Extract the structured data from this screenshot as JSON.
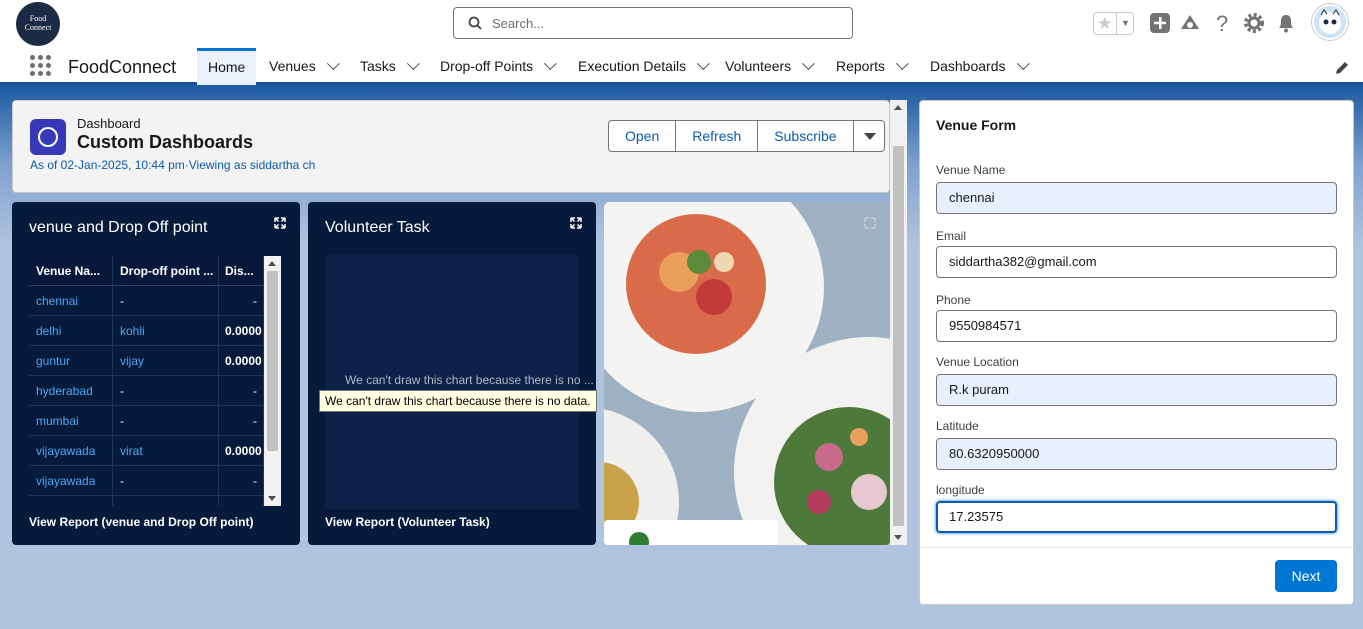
{
  "topbar": {
    "logo_text_line1": "Food",
    "logo_text_line2": "Connect",
    "search_placeholder": "Search..."
  },
  "nav": {
    "app_name": "FoodConnect",
    "tabs": [
      {
        "label": "Home",
        "active": true
      },
      {
        "label": "Venues"
      },
      {
        "label": "Tasks"
      },
      {
        "label": "Drop-off Points"
      },
      {
        "label": "Execution Details"
      },
      {
        "label": "Volunteers"
      },
      {
        "label": "Reports"
      },
      {
        "label": "Dashboards"
      }
    ]
  },
  "dashboard": {
    "breadcrumb": "Dashboard",
    "title": "Custom Dashboards",
    "as_of": "As of 02-Jan-2025, 10:44 pm·Viewing as siddartha ch",
    "buttons": {
      "open": "Open",
      "refresh": "Refresh",
      "subscribe": "Subscribe"
    }
  },
  "card1": {
    "title": "venue and Drop Off point",
    "columns": [
      "Venue Na...",
      "Drop-off point ...",
      "Dis..."
    ],
    "rows": [
      [
        "chennai",
        "-",
        "-"
      ],
      [
        "delhi",
        "kohli",
        "0.0000"
      ],
      [
        "guntur",
        "vijay",
        "0.0000"
      ],
      [
        "hyderabad",
        "-",
        "-"
      ],
      [
        "mumbai",
        "-",
        "-"
      ],
      [
        "vijayawada",
        "virat",
        "0.0000"
      ],
      [
        "vijayawada",
        "-",
        "-"
      ],
      [
        "",
        "",
        ""
      ]
    ],
    "view_report": "View Report (venue and Drop Off point)"
  },
  "card2": {
    "title": "Volunteer Task",
    "no_data_truncated": "We can't draw this chart because there is no ...",
    "tooltip": "We can't draw this chart because there is no data.",
    "view_report": "View Report (Volunteer Task)"
  },
  "form": {
    "title": "Venue Form",
    "fields": {
      "venue_name": {
        "label": "Venue Name",
        "value": "chennai"
      },
      "email": {
        "label": "Email",
        "value": "siddartha382@gmail.com"
      },
      "phone": {
        "label": "Phone",
        "value": "9550984571"
      },
      "venue_location": {
        "label": "Venue Location",
        "value": "R.k puram"
      },
      "latitude": {
        "label": "Latitude",
        "value": "80.6320950000"
      },
      "longitude": {
        "label": "longitude",
        "value": "17.23575"
      }
    },
    "next_label": "Next"
  },
  "colors": {
    "brand_blue": "#0176d3",
    "link_blue": "#0b5cab",
    "dark_card": "#061b3c",
    "header_band": "#1c5aa0"
  }
}
